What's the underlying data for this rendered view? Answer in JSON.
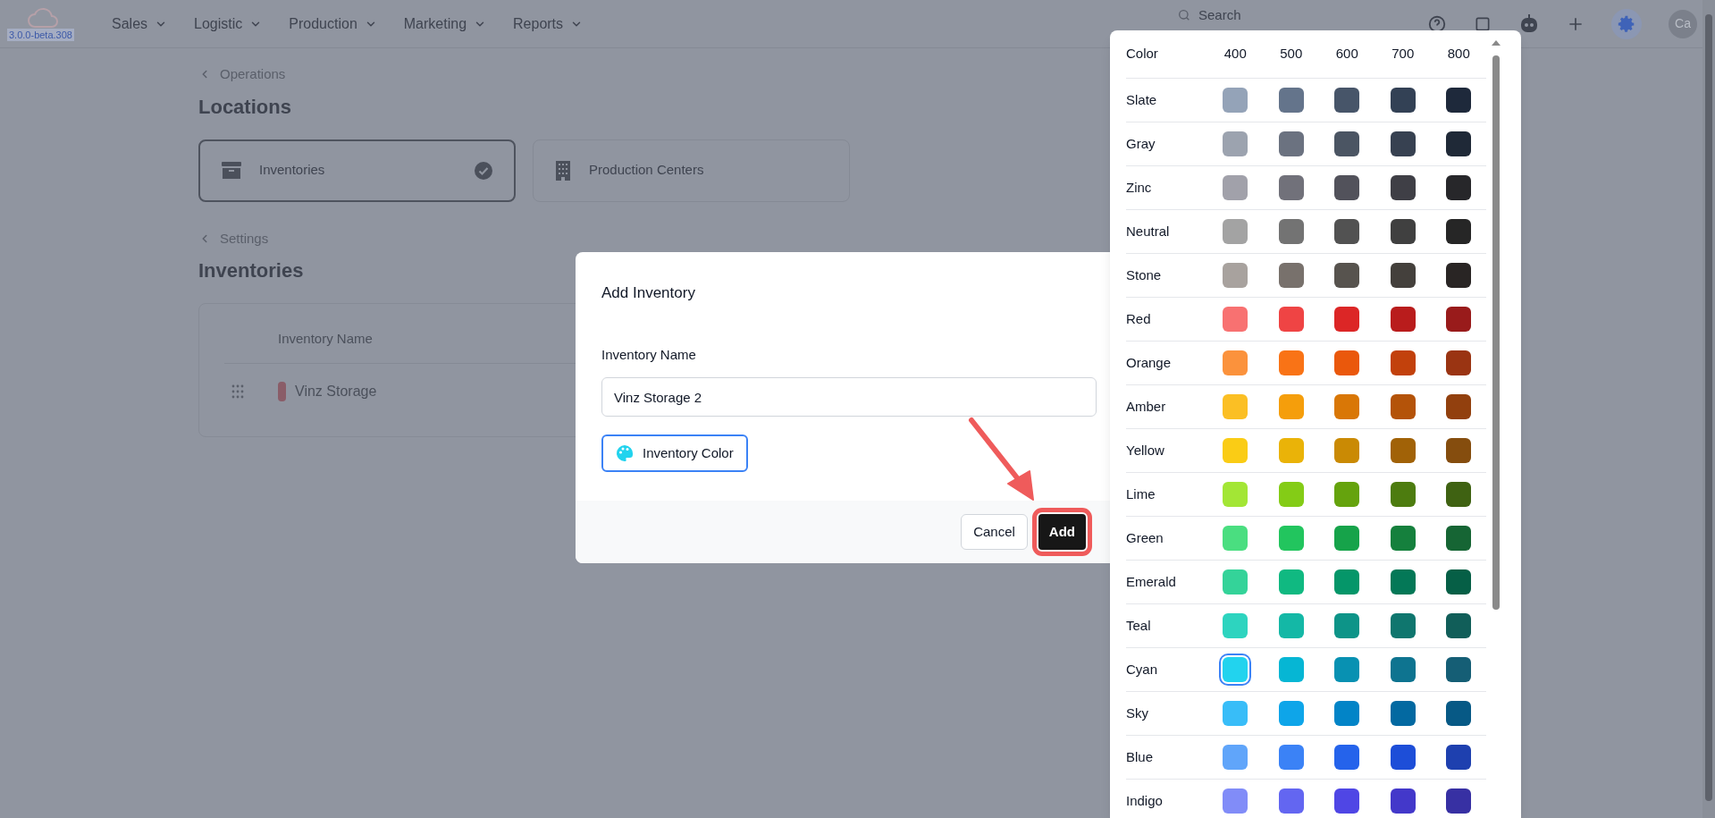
{
  "nav": {
    "version": "3.0.0-beta.308",
    "menu": [
      {
        "label": "Sales"
      },
      {
        "label": "Logistic"
      },
      {
        "label": "Production"
      },
      {
        "label": "Marketing"
      },
      {
        "label": "Reports"
      }
    ],
    "search": {
      "placeholder": "Search"
    },
    "avatar": "Ca"
  },
  "breadcrumb_top": "Operations",
  "heading_top": "Locations",
  "location_cards": [
    {
      "label": "Inventories",
      "kind": "archive",
      "selected": true
    },
    {
      "label": "Production Centers",
      "kind": "building",
      "selected": false
    }
  ],
  "breadcrumb_settings": "Settings",
  "heading_inventories": "Inventories",
  "table": {
    "columns": [
      "Inventory Name"
    ],
    "rows": [
      {
        "name": "Vinz Storage",
        "color": "#8a5d68"
      }
    ]
  },
  "dialog": {
    "title": "Add Inventory",
    "field": {
      "label": "Inventory Name",
      "value": "Vinz Storage 2"
    },
    "color_button": "Inventory Color",
    "buttons": [
      {
        "label": "Cancel",
        "kind": "secondary"
      },
      {
        "label": "Add",
        "kind": "primary"
      }
    ]
  },
  "color_picker": {
    "columns": [
      "Color",
      "400",
      "500",
      "600",
      "700",
      "800"
    ],
    "rows": [
      {
        "name": "Slate",
        "swatches": [
          {
            "color": "#94a3b8",
            "selected": false
          },
          {
            "color": "#64748b",
            "selected": false
          },
          {
            "color": "#475569",
            "selected": false
          },
          {
            "color": "#334155",
            "selected": false
          },
          {
            "color": "#1e293b",
            "selected": false
          }
        ]
      },
      {
        "name": "Gray",
        "swatches": [
          {
            "color": "#9ca3af",
            "selected": false
          },
          {
            "color": "#6b7280",
            "selected": false
          },
          {
            "color": "#4b5563",
            "selected": false
          },
          {
            "color": "#374151",
            "selected": false
          },
          {
            "color": "#1f2937",
            "selected": false
          }
        ]
      },
      {
        "name": "Zinc",
        "swatches": [
          {
            "color": "#a1a1aa",
            "selected": false
          },
          {
            "color": "#71717a",
            "selected": false
          },
          {
            "color": "#52525b",
            "selected": false
          },
          {
            "color": "#3f3f46",
            "selected": false
          },
          {
            "color": "#27272a",
            "selected": false
          }
        ]
      },
      {
        "name": "Neutral",
        "swatches": [
          {
            "color": "#a3a3a3",
            "selected": false
          },
          {
            "color": "#737373",
            "selected": false
          },
          {
            "color": "#525252",
            "selected": false
          },
          {
            "color": "#404040",
            "selected": false
          },
          {
            "color": "#262626",
            "selected": false
          }
        ]
      },
      {
        "name": "Stone",
        "swatches": [
          {
            "color": "#a8a29e",
            "selected": false
          },
          {
            "color": "#78716c",
            "selected": false
          },
          {
            "color": "#57534e",
            "selected": false
          },
          {
            "color": "#44403c",
            "selected": false
          },
          {
            "color": "#292524",
            "selected": false
          }
        ]
      },
      {
        "name": "Red",
        "swatches": [
          {
            "color": "#f87171",
            "selected": false
          },
          {
            "color": "#ef4444",
            "selected": false
          },
          {
            "color": "#dc2626",
            "selected": false
          },
          {
            "color": "#b91c1c",
            "selected": false
          },
          {
            "color": "#991b1b",
            "selected": false
          }
        ]
      },
      {
        "name": "Orange",
        "swatches": [
          {
            "color": "#fb923c",
            "selected": false
          },
          {
            "color": "#f97316",
            "selected": false
          },
          {
            "color": "#ea580c",
            "selected": false
          },
          {
            "color": "#c2410c",
            "selected": false
          },
          {
            "color": "#9a3412",
            "selected": false
          }
        ]
      },
      {
        "name": "Amber",
        "swatches": [
          {
            "color": "#fbbf24",
            "selected": false
          },
          {
            "color": "#f59e0b",
            "selected": false
          },
          {
            "color": "#d97706",
            "selected": false
          },
          {
            "color": "#b45309",
            "selected": false
          },
          {
            "color": "#92400e",
            "selected": false
          }
        ]
      },
      {
        "name": "Yellow",
        "swatches": [
          {
            "color": "#facc15",
            "selected": false
          },
          {
            "color": "#eab308",
            "selected": false
          },
          {
            "color": "#ca8a04",
            "selected": false
          },
          {
            "color": "#a16207",
            "selected": false
          },
          {
            "color": "#854d0e",
            "selected": false
          }
        ]
      },
      {
        "name": "Lime",
        "swatches": [
          {
            "color": "#a3e635",
            "selected": false
          },
          {
            "color": "#84cc16",
            "selected": false
          },
          {
            "color": "#65a30d",
            "selected": false
          },
          {
            "color": "#4d7c0f",
            "selected": false
          },
          {
            "color": "#3f6212",
            "selected": false
          }
        ]
      },
      {
        "name": "Green",
        "swatches": [
          {
            "color": "#4ade80",
            "selected": false
          },
          {
            "color": "#22c55e",
            "selected": false
          },
          {
            "color": "#16a34a",
            "selected": false
          },
          {
            "color": "#15803d",
            "selected": false
          },
          {
            "color": "#166534",
            "selected": false
          }
        ]
      },
      {
        "name": "Emerald",
        "swatches": [
          {
            "color": "#34d399",
            "selected": false
          },
          {
            "color": "#10b981",
            "selected": false
          },
          {
            "color": "#059669",
            "selected": false
          },
          {
            "color": "#047857",
            "selected": false
          },
          {
            "color": "#065f46",
            "selected": false
          }
        ]
      },
      {
        "name": "Teal",
        "swatches": [
          {
            "color": "#2dd4bf",
            "selected": false
          },
          {
            "color": "#14b8a6",
            "selected": false
          },
          {
            "color": "#0d9488",
            "selected": false
          },
          {
            "color": "#0f766e",
            "selected": false
          },
          {
            "color": "#115e59",
            "selected": false
          }
        ]
      },
      {
        "name": "Cyan",
        "swatches": [
          {
            "color": "#22d3ee",
            "selected": true
          },
          {
            "color": "#06b6d4",
            "selected": false
          },
          {
            "color": "#0891b2",
            "selected": false
          },
          {
            "color": "#0e7490",
            "selected": false
          },
          {
            "color": "#155e75",
            "selected": false
          }
        ]
      },
      {
        "name": "Sky",
        "swatches": [
          {
            "color": "#38bdf8",
            "selected": false
          },
          {
            "color": "#0ea5e9",
            "selected": false
          },
          {
            "color": "#0284c7",
            "selected": false
          },
          {
            "color": "#0369a1",
            "selected": false
          },
          {
            "color": "#075985",
            "selected": false
          }
        ]
      },
      {
        "name": "Blue",
        "swatches": [
          {
            "color": "#60a5fa",
            "selected": false
          },
          {
            "color": "#3b82f6",
            "selected": false
          },
          {
            "color": "#2563eb",
            "selected": false
          },
          {
            "color": "#1d4ed8",
            "selected": false
          },
          {
            "color": "#1e40af",
            "selected": false
          }
        ]
      },
      {
        "name": "Indigo",
        "swatches": [
          {
            "color": "#818cf8",
            "selected": false
          },
          {
            "color": "#6366f1",
            "selected": false
          },
          {
            "color": "#4f46e5",
            "selected": false
          },
          {
            "color": "#4338ca",
            "selected": false
          },
          {
            "color": "#3730a3",
            "selected": false
          }
        ]
      }
    ]
  }
}
